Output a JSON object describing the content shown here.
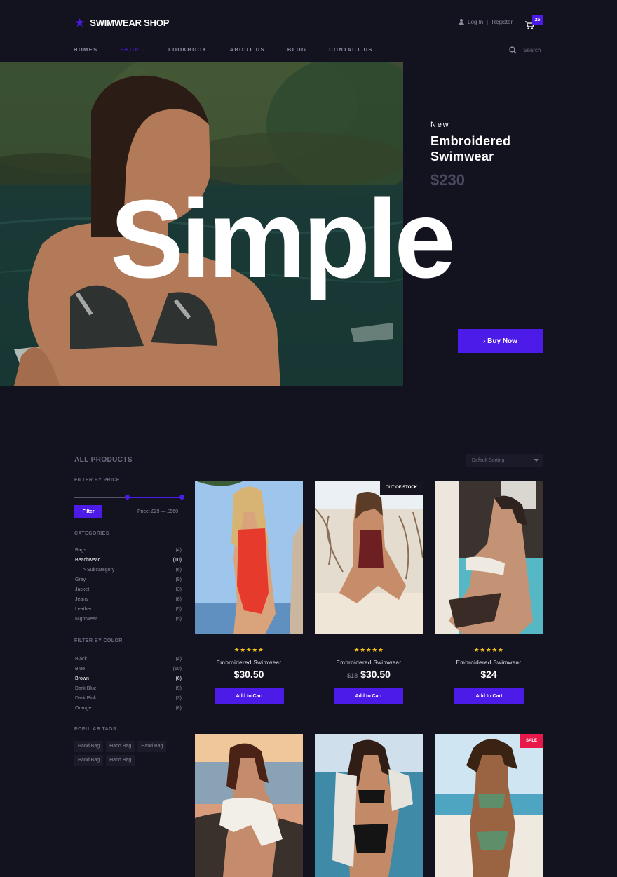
{
  "brand": {
    "name": "SWIMWEAR SHOP"
  },
  "account": {
    "login": "Log In",
    "separator": "|",
    "register": "Register"
  },
  "cart": {
    "count": "25"
  },
  "nav": {
    "items": [
      "HOMES",
      "SHOP",
      "LOOKBOOK",
      "ABOUT US",
      "BLOG",
      "CONTACT US"
    ],
    "active": "SHOP"
  },
  "search": {
    "placeholder": "Search"
  },
  "hero": {
    "kicker": "New",
    "title_line1": "Embroidered",
    "title_line2": "Swimwear",
    "price": "$230",
    "big_word": "Simple",
    "button": "› Buy Now"
  },
  "catalog": {
    "heading": "ALL PRODUCTS",
    "sorting": "Default Sorting",
    "price_filter": {
      "heading": "FILTER BY PRICE",
      "button": "Filter",
      "range": "Price: £29 — £560",
      "range_fraction": [
        0.49,
        1.0
      ]
    },
    "categories": {
      "heading": "CATEGORIES",
      "items": [
        {
          "label": "Bags",
          "count": "(4)"
        },
        {
          "label": "Beachwear",
          "count": "(10)"
        },
        {
          "label": "> Subcategory",
          "count": "(6)"
        },
        {
          "label": "Grey",
          "count": "(9)"
        },
        {
          "label": "Jacket",
          "count": "(3)"
        },
        {
          "label": "Jeans",
          "count": "(8)"
        },
        {
          "label": "Leather",
          "count": "(5)"
        },
        {
          "label": "Nightwear",
          "count": "(5)"
        }
      ]
    },
    "colors": {
      "heading": "FILTER BY COLOR",
      "items": [
        {
          "label": "Black",
          "count": "(4)"
        },
        {
          "label": "Blue",
          "count": "(10)"
        },
        {
          "label": "Brown",
          "count": "(6)"
        },
        {
          "label": "Dark Blue",
          "count": "(9)"
        },
        {
          "label": "Dark Pink",
          "count": "(3)"
        },
        {
          "label": "Orange",
          "count": "(8)"
        }
      ]
    },
    "tags": {
      "heading": "POPULAR TAGS",
      "items": [
        "Hand Bag",
        "Hand Bag",
        "Hand Bag",
        "Hand Bag",
        "Hand Bag"
      ]
    }
  },
  "products": [
    {
      "name": "Embroidered Swimwear",
      "price": "$30.50",
      "old_price": "",
      "rating": "★★★★★",
      "button": "Add to Cart",
      "flag": ""
    },
    {
      "name": "Embroidered Swimwear",
      "price": "$30.50",
      "old_price": "$18",
      "rating": "★★★★★",
      "button": "Add to Cart",
      "flag": "OUT OF STOCK"
    },
    {
      "name": "Embroidered Swimwear",
      "price": "$24",
      "old_price": "",
      "rating": "★★★★★",
      "button": "Add to Cart",
      "flag": ""
    },
    {
      "flag": ""
    },
    {
      "flag": ""
    },
    {
      "flag": "SALE"
    }
  ],
  "colors": {
    "accent": "#4d1be8",
    "background": "#13121f",
    "sale": "#e8184a",
    "star": "#f6c21a"
  }
}
